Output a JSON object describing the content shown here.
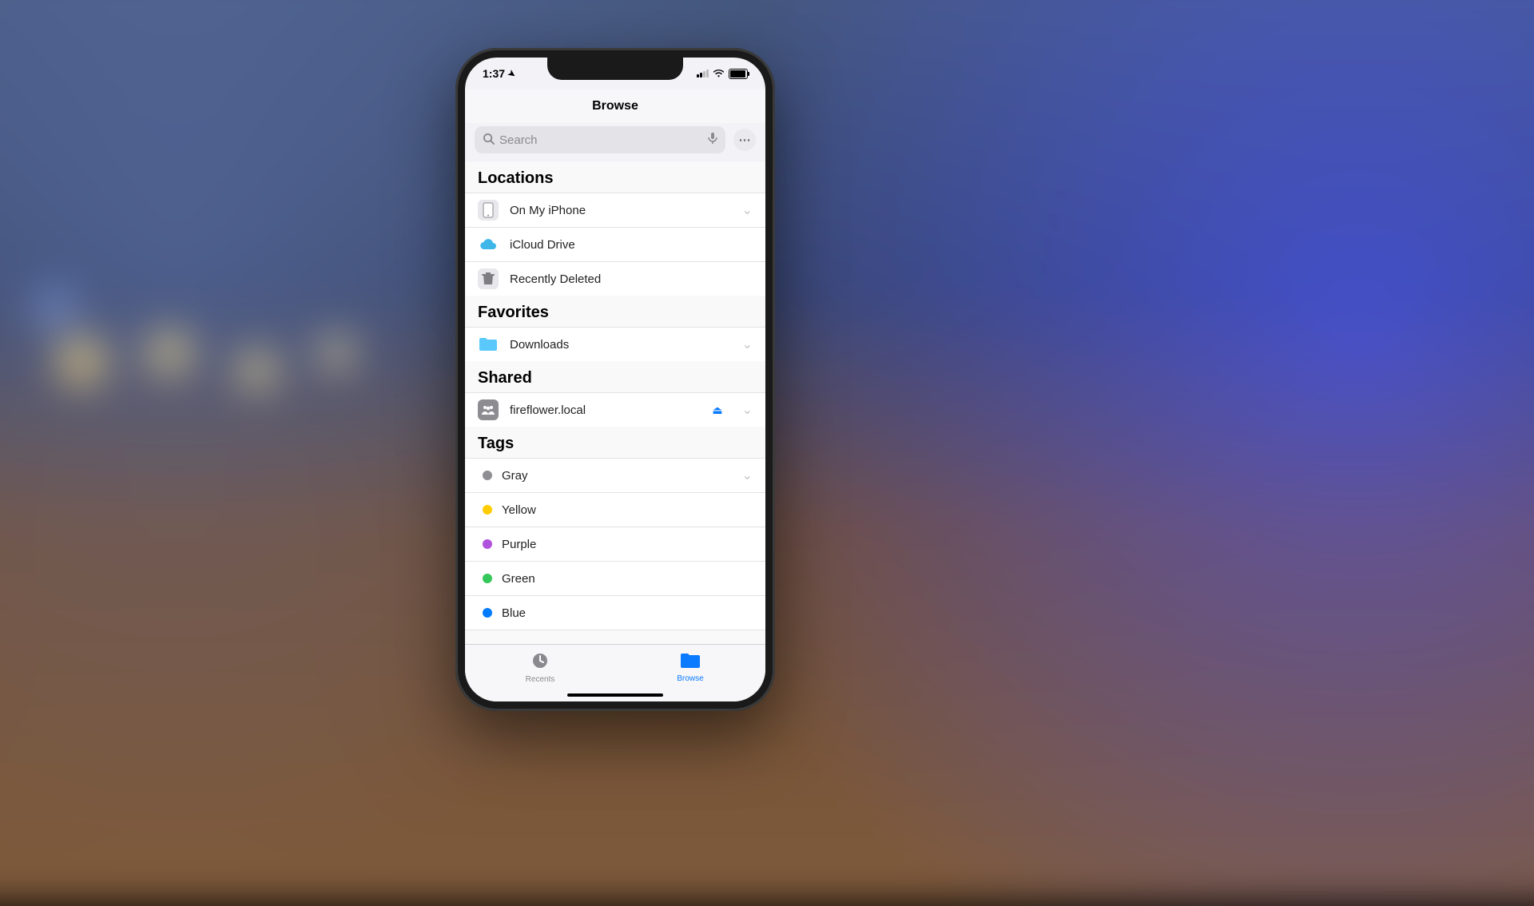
{
  "status": {
    "time": "1:37"
  },
  "nav": {
    "title": "Browse"
  },
  "search": {
    "placeholder": "Search"
  },
  "sections": {
    "locations": {
      "header": "Locations",
      "items": [
        {
          "label": "On My iPhone"
        },
        {
          "label": "iCloud Drive"
        },
        {
          "label": "Recently Deleted"
        }
      ]
    },
    "favorites": {
      "header": "Favorites",
      "items": [
        {
          "label": "Downloads"
        }
      ]
    },
    "shared": {
      "header": "Shared",
      "items": [
        {
          "label": "fireflower.local"
        }
      ]
    },
    "tags": {
      "header": "Tags",
      "items": [
        {
          "label": "Gray",
          "color": "#8e8e93"
        },
        {
          "label": "Yellow",
          "color": "#ffcc00"
        },
        {
          "label": "Purple",
          "color": "#af52de"
        },
        {
          "label": "Green",
          "color": "#34c759"
        },
        {
          "label": "Blue",
          "color": "#007aff"
        }
      ]
    }
  },
  "tabs": {
    "recents": "Recents",
    "browse": "Browse"
  }
}
